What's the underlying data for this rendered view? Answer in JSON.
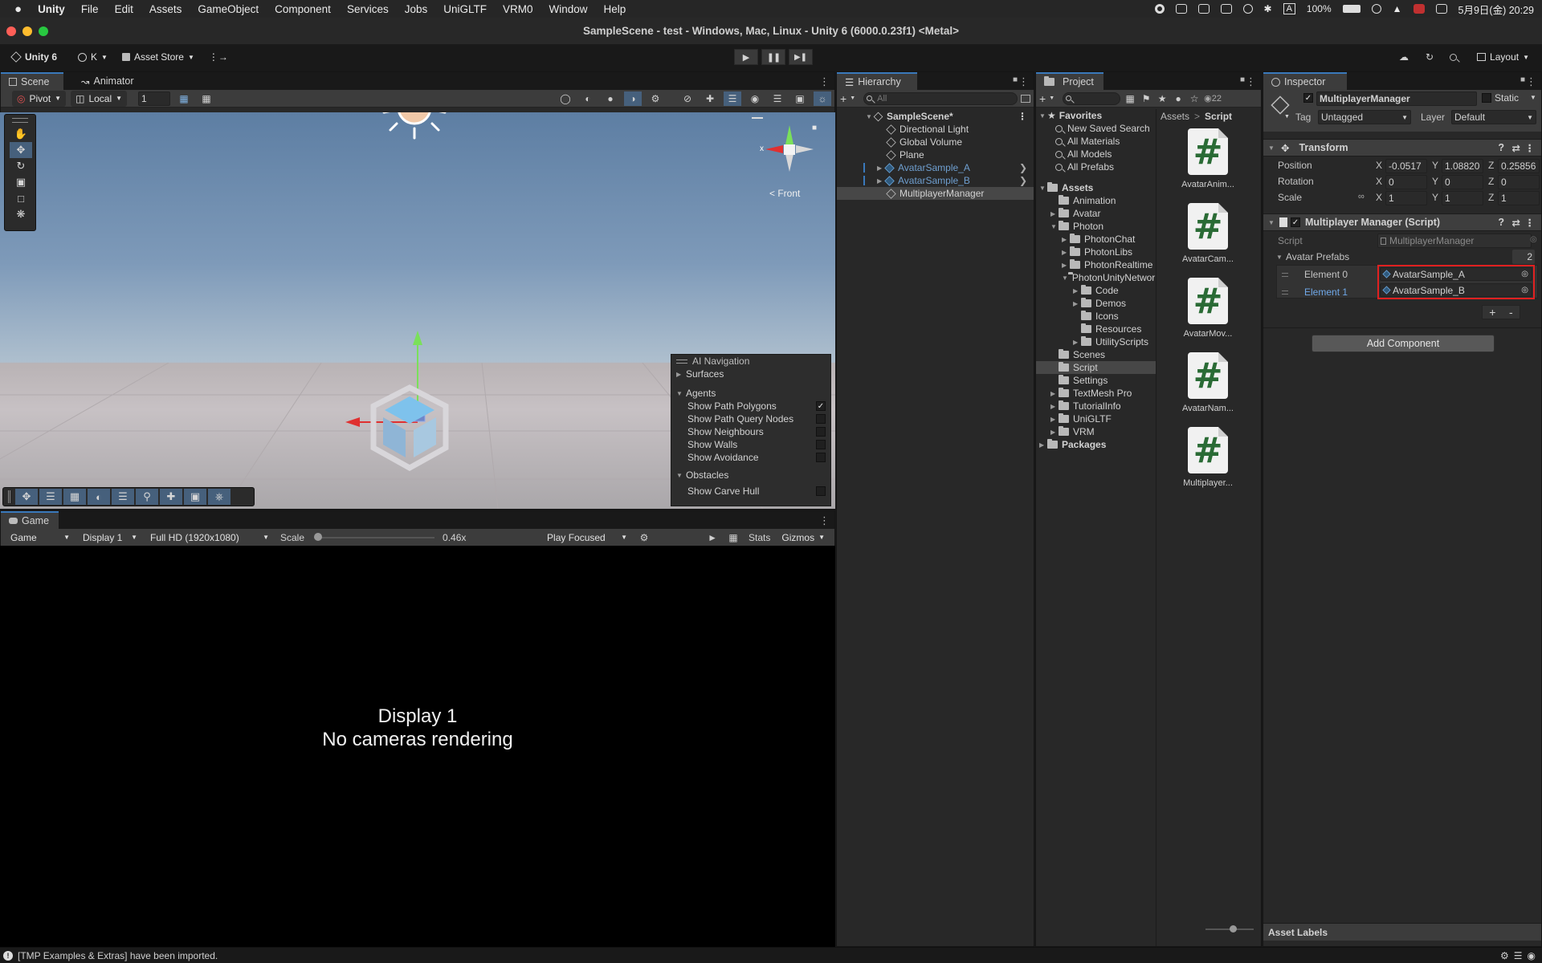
{
  "menubar": {
    "app": "Unity",
    "items": [
      "File",
      "Edit",
      "Assets",
      "GameObject",
      "Component",
      "Services",
      "Jobs",
      "UniGLTF",
      "VRM0",
      "Window",
      "Help"
    ],
    "battery": "100%",
    "input_mode": "A",
    "clock": "5月9日(金)  20:29"
  },
  "window": {
    "title": "SampleScene - test - Windows, Mac, Linux - Unity 6 (6000.0.23f1) <Metal>"
  },
  "toolbar": {
    "unity_label": "Unity 6",
    "account": "K",
    "asset_store": "Asset Store",
    "layout": "Layout"
  },
  "scene": {
    "tabs": [
      "Scene",
      "Animator"
    ],
    "pivot": "Pivot",
    "local": "Local",
    "grid_value": "1",
    "gizmo_label": "< Front",
    "gizmo_x": "x"
  },
  "ai_nav": {
    "title": "AI Navigation",
    "surfaces": "Surfaces",
    "agents": "Agents",
    "agent_options": [
      {
        "label": "Show Path Polygons",
        "check": "✓"
      },
      {
        "label": "Show Path Query Nodes",
        "check": ""
      },
      {
        "label": "Show Neighbours",
        "check": ""
      },
      {
        "label": "Show Walls",
        "check": ""
      },
      {
        "label": "Show Avoidance",
        "check": ""
      }
    ],
    "obstacles": "Obstacles",
    "obstacle_options": [
      {
        "label": "Show Carve Hull",
        "check": ""
      }
    ]
  },
  "game": {
    "tab": "Game",
    "mode": "Game",
    "display": "Display 1",
    "resolution": "Full HD (1920x1080)",
    "scale_label": "Scale",
    "scale_value": "0.46x",
    "play_mode": "Play Focused",
    "stats": "Stats",
    "gizmos": "Gizmos",
    "message_line1": "Display 1",
    "message_line2": "No cameras rendering"
  },
  "hierarchy": {
    "tab": "Hierarchy",
    "search_placeholder": "All",
    "scene": "SampleScene*",
    "items": [
      "Directional Light",
      "Global Volume",
      "Plane",
      "AvatarSample_A",
      "AvatarSample_B",
      "MultiplayerManager"
    ]
  },
  "project": {
    "tab": "Project",
    "count": "22",
    "favorites": "Favorites",
    "favorite_items": [
      "New Saved Search",
      "All Materials",
      "All Models",
      "All Prefabs"
    ],
    "assets": "Assets",
    "folders": [
      "Animation",
      "Avatar",
      "Photon",
      "PhotonChat",
      "PhotonLibs",
      "PhotonRealtime",
      "PhotonUnityNetworking",
      "Code",
      "Demos",
      "Icons",
      "Resources",
      "UtilityScripts",
      "Scenes",
      "Script",
      "Settings",
      "TextMesh Pro",
      "TutorialInfo",
      "UniGLTF",
      "VRM"
    ],
    "packages": "Packages",
    "breadcrumb": [
      "Assets",
      "Script"
    ],
    "breadcrumb_sep": ">",
    "assets_grid": [
      "AvatarAnim...",
      "AvatarCam...",
      "AvatarMov...",
      "AvatarNam...",
      "Multiplayer..."
    ],
    "script_glyph": "#"
  },
  "inspector": {
    "tab": "Inspector",
    "object_name": "MultiplayerManager",
    "static_label": "Static",
    "tag_label": "Tag",
    "tag_value": "Untagged",
    "layer_label": "Layer",
    "layer_value": "Default",
    "transform": {
      "title": "Transform",
      "position_label": "Position",
      "position": [
        "-0.0517",
        "1.08820",
        "0.25856"
      ],
      "rotation_label": "Rotation",
      "rotation": [
        "0",
        "0",
        "0"
      ],
      "scale_label": "Scale",
      "scale": [
        "1",
        "1",
        "1"
      ],
      "axes": [
        "X",
        "Y",
        "Z"
      ]
    },
    "script_component": {
      "title": "Multiplayer Manager (Script)",
      "script_label": "Script",
      "script_value": "MultiplayerManager",
      "list_label": "Avatar Prefabs",
      "list_count": "2",
      "elements": [
        {
          "label": "Element 0",
          "value": "AvatarSample_A"
        },
        {
          "label": "Element 1",
          "value": "AvatarSample_B"
        }
      ],
      "plus": "+",
      "minus": "-"
    },
    "add_component": "Add Component",
    "asset_labels": "Asset Labels",
    "highlight_color": "#e02020"
  },
  "status": {
    "message": "[TMP Examples & Extras] have been imported."
  }
}
